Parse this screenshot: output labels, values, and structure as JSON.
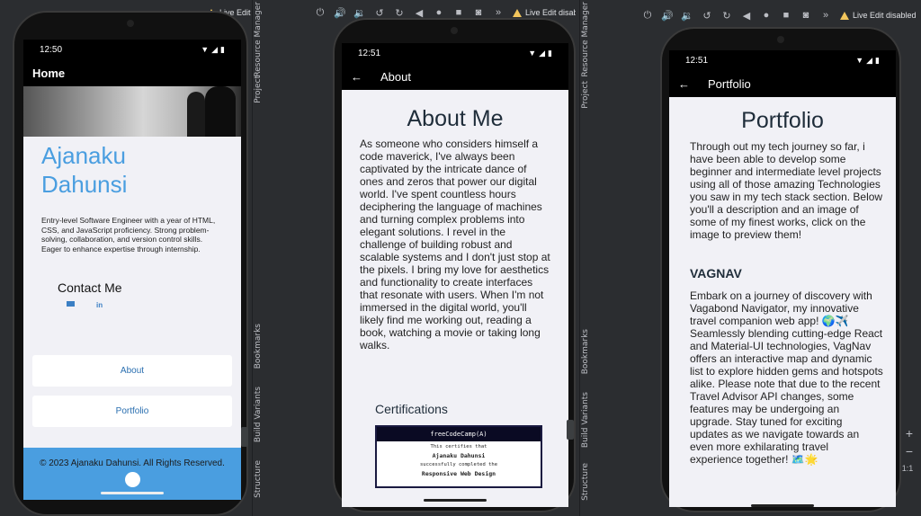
{
  "ide": {
    "live_edit_label": "Live Edit disabled",
    "panel_labels_left": [
      "Resource Manager",
      "Project"
    ],
    "panel_labels_left_bottom": [
      "Bookmarks",
      "Build Variants",
      "Structure"
    ],
    "zoom_plus": "+",
    "zoom_minus": "−",
    "zoom_reset": "1:1"
  },
  "phone_home": {
    "time": "12:50",
    "appbar_title": "Home",
    "name": "Ajanaku Dahunsi",
    "bio": "Entry-level Software Engineer with a year of HTML, CSS, and JavaScript proficiency. Strong problem-solving, collaboration, and version control skills. Eager to enhance expertise through internship.",
    "contact_title": "Contact Me",
    "linkedin_label": "in",
    "about_button": "About",
    "portfolio_button": "Portfolio",
    "footer_text": "© 2023 Ajanaku Dahunsi. All Rights Reserved."
  },
  "phone_about": {
    "time": "12:51",
    "appbar_title": "About",
    "title": "About Me",
    "body": "As someone who considers himself a code maverick, I've always been captivated by the intricate dance of ones and zeros that power our digital world. I've spent countless hours deciphering the language of machines and turning complex problems into elegant solutions. I revel in the challenge of building robust and scalable systems and I don't just stop at the pixels. I bring my love for aesthetics and functionality to create interfaces that resonate with users. When I'm not immersed in the digital world, you'll likely find me working out, reading a book, watching a movie or taking long walks.",
    "certifications_title": "Certifications",
    "cert_header": "freeCodeCamp(A)",
    "cert_line1": "This certifies that",
    "cert_name": "Ajanaku Dahunsi",
    "cert_line2": "successfully completed the",
    "cert_course": "Responsive Web Design"
  },
  "phone_portfolio": {
    "time": "12:51",
    "appbar_title": "Portfolio",
    "title": "Portfolio",
    "intro": "Through out my tech journey so far, i have been able to develop some beginner and intermediate level projects using all of those amazing Technologies you saw in my tech stack section. Below you'll a description and an image of some of my finest works, click on the image to preview them!",
    "project_title": "VAGNAV",
    "project_desc": "Embark on a journey of discovery with Vagabond Navigator, my innovative travel companion web app! 🌍✈️ Seamlessly blending cutting-edge React and Material-UI technologies, VagNav offers an interactive map and dynamic list to explore hidden gems and hotspots alike. Please note that due to the recent Travel Advisor API changes, some features may be undergoing an upgrade. Stay tuned for exciting updates as we navigate towards an even more exhilarating travel experience together! 🗺️🌟"
  },
  "colors": {
    "accent_blue": "#4a9ee0",
    "title_dark": "#1f2d3a",
    "ide_bg": "#2b2d30"
  }
}
